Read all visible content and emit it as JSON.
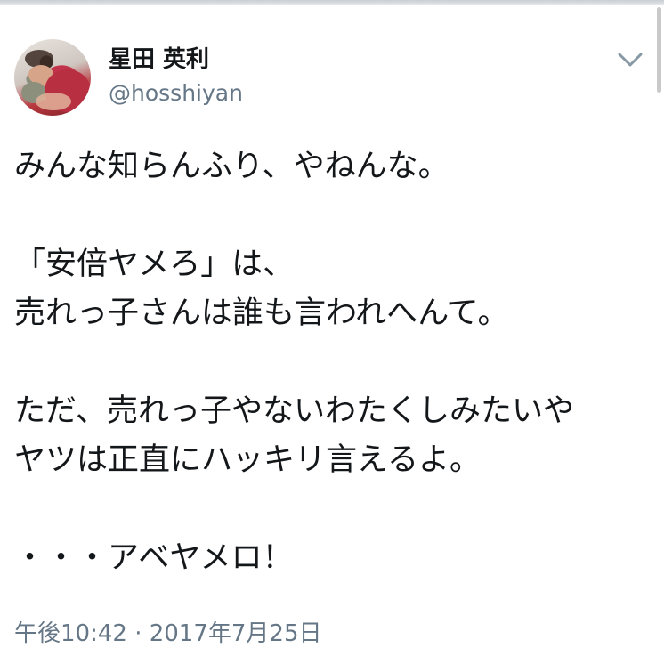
{
  "tweet": {
    "author": {
      "display_name": "星田 英利",
      "handle": "@hosshiyan"
    },
    "menu_icon": "chevron-down-icon",
    "text": "みんな知らんふり、やねんな。\n\n「安倍ヤメろ」は、\n売れっ子さんは誰も言われへんて。\n\nただ、売れっ子やないわたくしみたいや\nヤツは正直にハッキリ言えるよ。\n\n・・・アベヤメロ！",
    "timestamp": "午後10:42 · 2017年7月25日"
  },
  "colors": {
    "text": "#14171a",
    "secondary_text": "#657786",
    "background": "#ffffff"
  }
}
